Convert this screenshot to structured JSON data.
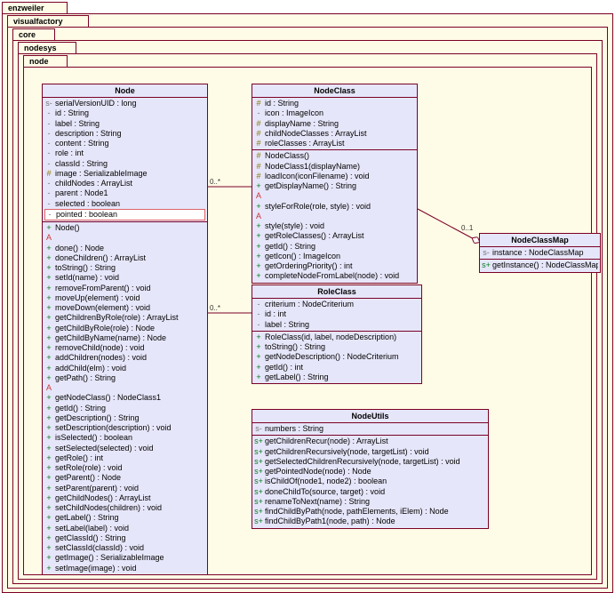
{
  "packages": [
    "enzweiler",
    "visualfactory",
    "core",
    "nodesys",
    "node"
  ],
  "classes": {
    "Node": {
      "name": "Node",
      "attrs": [
        {
          "v": "s-",
          "t": "serialVersionUID : long"
        },
        {
          "v": "-",
          "t": "id : String"
        },
        {
          "v": "-",
          "t": "label : String"
        },
        {
          "v": "-",
          "t": "description : String"
        },
        {
          "v": "-",
          "t": "content : String"
        },
        {
          "v": "-",
          "t": "role : int"
        },
        {
          "v": "-",
          "t": "classId : String"
        },
        {
          "v": "#",
          "t": "image : SerializableImage"
        },
        {
          "v": "-",
          "t": "childNodes : ArrayList"
        },
        {
          "v": "-",
          "t": "parent : Node1"
        },
        {
          "v": "-",
          "t": "selected : boolean"
        },
        {
          "v": "-",
          "t": "pointed : boolean",
          "hl": true
        }
      ],
      "ops": [
        {
          "v": "+",
          "t": "Node()"
        },
        {
          "v": "A",
          "t": ""
        },
        {
          "v": "+",
          "t": "done() : Node"
        },
        {
          "v": "+",
          "t": "doneChildren() : ArrayList"
        },
        {
          "v": "+",
          "t": "toString() : String"
        },
        {
          "v": "+",
          "t": "setId(name) : void"
        },
        {
          "v": "+",
          "t": "removeFromParent() : void"
        },
        {
          "v": "+",
          "t": "moveUp(element) : void"
        },
        {
          "v": "+",
          "t": "moveDown(element) : void"
        },
        {
          "v": "+",
          "t": "getChildrenByRole(role) : ArrayList"
        },
        {
          "v": "+",
          "t": "getChildByRole(role) : Node"
        },
        {
          "v": "+",
          "t": "getChildByName(name) : Node"
        },
        {
          "v": "+",
          "t": "removeChild(node) : void"
        },
        {
          "v": "+",
          "t": "addChildren(nodes) : void"
        },
        {
          "v": "+",
          "t": "addChild(elm) : void"
        },
        {
          "v": "+",
          "t": "getPath() : String"
        },
        {
          "v": "A",
          "t": ""
        },
        {
          "v": "+",
          "t": "getNodeClass() : NodeClass1"
        },
        {
          "v": "+",
          "t": "getId() : String"
        },
        {
          "v": "+",
          "t": "getDescription() : String"
        },
        {
          "v": "+",
          "t": "setDescription(description) : void"
        },
        {
          "v": "+",
          "t": "isSelected() : boolean"
        },
        {
          "v": "+",
          "t": "setSelected(selected) : void"
        },
        {
          "v": "+",
          "t": "getRole() : int"
        },
        {
          "v": "+",
          "t": "setRole(role) : void"
        },
        {
          "v": "+",
          "t": "getParent() : Node"
        },
        {
          "v": "+",
          "t": "setParent(parent) : void"
        },
        {
          "v": "+",
          "t": "getChildNodes() : ArrayList"
        },
        {
          "v": "+",
          "t": "setChildNodes(children) : void"
        },
        {
          "v": "+",
          "t": "getLabel() : String"
        },
        {
          "v": "+",
          "t": "setLabel(label) : void"
        },
        {
          "v": "+",
          "t": "getClassId() : String"
        },
        {
          "v": "+",
          "t": "setClassId(classId) : void"
        },
        {
          "v": "+",
          "t": "getImage() : SerializableImage"
        },
        {
          "v": "+",
          "t": "setImage(image) : void"
        }
      ]
    },
    "NodeClass": {
      "name": "NodeClass",
      "attrs": [
        {
          "v": "#",
          "t": "id : String"
        },
        {
          "v": "-",
          "t": "icon : ImageIcon"
        },
        {
          "v": "#",
          "t": "displayName : String"
        },
        {
          "v": "#",
          "t": "childNodeClasses : ArrayList"
        },
        {
          "v": "#",
          "t": "roleClasses : ArrayList"
        }
      ],
      "ops": [
        {
          "v": "#",
          "t": "NodeClass()"
        },
        {
          "v": "#",
          "t": "NodeClass1(displayName)"
        },
        {
          "v": "#",
          "t": "loadIcon(iconFilename) : void"
        },
        {
          "v": "+",
          "t": "getDisplayName() : String"
        },
        {
          "v": "A",
          "t": ""
        },
        {
          "v": "+",
          "t": "styleForRole(role, style) : void"
        },
        {
          "v": "A",
          "t": ""
        },
        {
          "v": "+",
          "t": "style(style) : void"
        },
        {
          "v": "+",
          "t": "getRoleClasses() : ArrayList"
        },
        {
          "v": "+",
          "t": "getId() : String"
        },
        {
          "v": "+",
          "t": "getIcon() : ImageIcon"
        },
        {
          "v": "+",
          "t": "getOrderingPriority() : int"
        },
        {
          "v": "+",
          "t": "completeNodeFromLabel(node) : void"
        }
      ]
    },
    "NodeClassMap": {
      "name": "NodeClassMap",
      "attrs": [
        {
          "v": "s-",
          "t": "instance : NodeClassMap"
        }
      ],
      "ops": [
        {
          "v": "s+",
          "t": "getInstance() : NodeClassMap"
        }
      ]
    },
    "RoleClass": {
      "name": "RoleClass",
      "attrs": [
        {
          "v": "-",
          "t": "criterium : NodeCriterium"
        },
        {
          "v": "-",
          "t": "id : int"
        },
        {
          "v": "-",
          "t": "label : String"
        }
      ],
      "ops": [
        {
          "v": "+",
          "t": "RoleClass(id, label, nodeDescription)"
        },
        {
          "v": "+",
          "t": "toString() : String"
        },
        {
          "v": "+",
          "t": "getNodeDescription() : NodeCriterium"
        },
        {
          "v": "+",
          "t": "getId() : int"
        },
        {
          "v": "+",
          "t": "getLabel() : String"
        }
      ]
    },
    "NodeUtils": {
      "name": "NodeUtils",
      "attrs": [
        {
          "v": "s-",
          "t": "numbers : String"
        }
      ],
      "ops": [
        {
          "v": "s+",
          "t": "getChildrenRecur(node) : ArrayList"
        },
        {
          "v": "s+",
          "t": "getChildrenRecursively(node, targetList) : void"
        },
        {
          "v": "s+",
          "t": "getSelectedChildrenRecursively(node, targetList) : void"
        },
        {
          "v": "s+",
          "t": "getPointedNode(node) : Node"
        },
        {
          "v": "s+",
          "t": "isChildOf(node1, node2) : boolean"
        },
        {
          "v": "s+",
          "t": "doneChildTo(source, target) : void"
        },
        {
          "v": "s+",
          "t": "renameToNext(name) : String"
        },
        {
          "v": "s+",
          "t": "findChildByPath(node, pathElements, iElem) : Node"
        },
        {
          "v": "s+",
          "t": "findChildByPath1(node, path) : Node"
        }
      ]
    }
  },
  "mults": {
    "m1label": "0..*",
    "m2label": "0..1",
    "m3label": "0..*"
  }
}
